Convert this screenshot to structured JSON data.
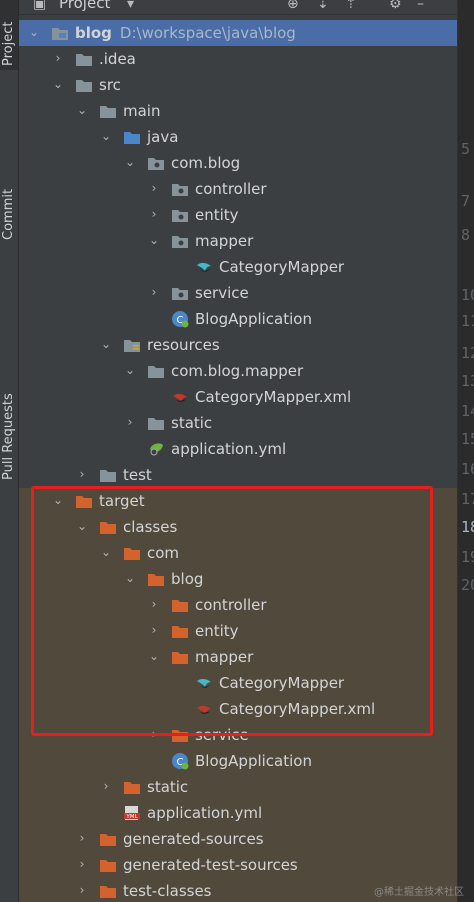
{
  "toolwindow": {
    "title": "Project"
  },
  "side_tabs": {
    "project": "Project",
    "commit": "Commit",
    "pull_requests": "Pull Requests"
  },
  "root": {
    "name": "blog",
    "path": "D:\\workspace\\java\\blog"
  },
  "tree": {
    "idea": ".idea",
    "src": "src",
    "main": "main",
    "java": "java",
    "com_blog": "com.blog",
    "controller": "controller",
    "entity": "entity",
    "mapper": "mapper",
    "category_mapper": "CategoryMapper",
    "service": "service",
    "blog_application": "BlogApplication",
    "resources": "resources",
    "com_blog_mapper": "com.blog.mapper",
    "category_mapper_xml": "CategoryMapper.xml",
    "static": "static",
    "application_yml": "application.yml",
    "test": "test",
    "target": "target",
    "classes": "classes",
    "com": "com",
    "blog": "blog",
    "t_controller": "controller",
    "t_entity": "entity",
    "t_mapper": "mapper",
    "t_category_mapper": "CategoryMapper",
    "t_category_mapper_xml": "CategoryMapper.xml",
    "t_service": "service",
    "t_blog_application": "BlogApplication",
    "t_static": "static",
    "t_application_yml": "application.yml",
    "generated_sources": "generated-sources",
    "generated_test_sources": "generated-test-sources",
    "test_classes": "test-classes"
  },
  "gutter_lines": [
    "5",
    "7",
    "8",
    "10",
    "11",
    "12",
    "13",
    "14",
    "15",
    "16",
    "17",
    "18",
    "19",
    "20"
  ],
  "watermark": "@稀土掘金技术社区"
}
